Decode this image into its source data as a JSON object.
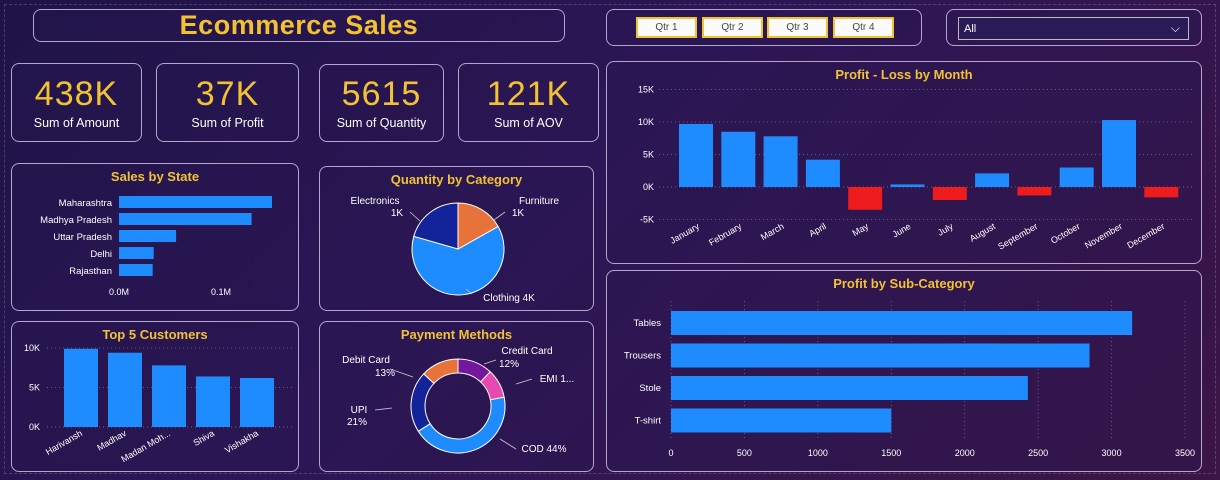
{
  "header": {
    "title": "Ecommerce Sales",
    "quarters": [
      "Qtr 1",
      "Qtr 2",
      "Qtr 3",
      "Qtr 4"
    ],
    "filter_value": "All"
  },
  "kpis": [
    {
      "value": "438K",
      "label": "Sum of Amount"
    },
    {
      "value": "37K",
      "label": "Sum of Profit"
    },
    {
      "value": "5615",
      "label": "Sum of Quantity"
    },
    {
      "value": "121K",
      "label": "Sum of AOV"
    }
  ],
  "colors": {
    "accent": "#f2c230",
    "bar": "#1e8cff",
    "negative": "#ee1c1c"
  },
  "chart_data": [
    {
      "id": "sales_by_state",
      "type": "bar",
      "orientation": "horizontal",
      "title": "Sales by State",
      "categories": [
        "Maharashtra",
        "Madhya Pradesh",
        "Uttar Pradesh",
        "Delhi",
        "Rajasthan"
      ],
      "values": [
        0.15,
        0.13,
        0.056,
        0.034,
        0.033
      ],
      "x_ticks": [
        "0.0M",
        "0.1M"
      ],
      "xlim": [
        0,
        0.1
      ],
      "grid": false
    },
    {
      "id": "quantity_by_category",
      "type": "pie",
      "title": "Quantity by Category",
      "labels": [
        "Clothing",
        "Electronics",
        "Furniture"
      ],
      "values": [
        3516,
        1154,
        945
      ],
      "data_labels": [
        "Clothing 4K",
        "Electronics",
        "Furniture"
      ],
      "data_values": [
        "",
        "1K",
        "1K"
      ],
      "colors": [
        "#1e8cff",
        "#13239a",
        "#e8733a"
      ]
    },
    {
      "id": "top_customers",
      "type": "bar",
      "title": "Top 5 Customers",
      "categories": [
        "Harivansh",
        "Madhav",
        "Madan Moh...",
        "Shiva",
        "Vishakha"
      ],
      "values": [
        9900,
        9400,
        7800,
        6400,
        6200
      ],
      "y_ticks": [
        "10K",
        "5K",
        "0K"
      ],
      "ylim": [
        0,
        10000
      ],
      "grid": true
    },
    {
      "id": "payment_methods",
      "type": "pie",
      "subtype": "donut",
      "title": "Payment Methods",
      "labels": [
        "COD",
        "UPI",
        "Debit Card",
        "Credit Card",
        "EMI"
      ],
      "values": [
        44,
        21,
        13,
        12,
        10
      ],
      "data_labels": [
        "COD 44%",
        "UPI",
        "Debit Card",
        "Credit Card",
        "EMI 1..."
      ],
      "data_values": [
        "",
        "21%",
        "13%",
        "12%",
        ""
      ],
      "colors": [
        "#1e8cff",
        "#13239a",
        "#e8733a",
        "#73179f",
        "#e64ab1"
      ]
    },
    {
      "id": "profit_loss_by_month",
      "type": "bar",
      "title": "Profit - Loss by Month",
      "categories": [
        "January",
        "February",
        "March",
        "April",
        "May",
        "June",
        "July",
        "August",
        "September",
        "October",
        "November",
        "December"
      ],
      "values": [
        9700,
        8500,
        7800,
        4200,
        -3500,
        400,
        -2000,
        2100,
        -1300,
        3000,
        10300,
        -1600
      ],
      "y_ticks": [
        "15K",
        "10K",
        "5K",
        "0K",
        "-5K"
      ],
      "ylim": [
        -5000,
        15000
      ],
      "grid": true
    },
    {
      "id": "profit_by_subcategory",
      "type": "bar",
      "orientation": "horizontal",
      "title": "Profit by Sub-Category",
      "categories": [
        "Tables",
        "Trousers",
        "Stole",
        "T-shirt"
      ],
      "values": [
        3140,
        2850,
        2430,
        1500
      ],
      "x_ticks": [
        "0",
        "500",
        "1000",
        "1500",
        "2000",
        "2500",
        "3000",
        "3500"
      ],
      "xlim": [
        0,
        3500
      ],
      "grid": true
    }
  ]
}
